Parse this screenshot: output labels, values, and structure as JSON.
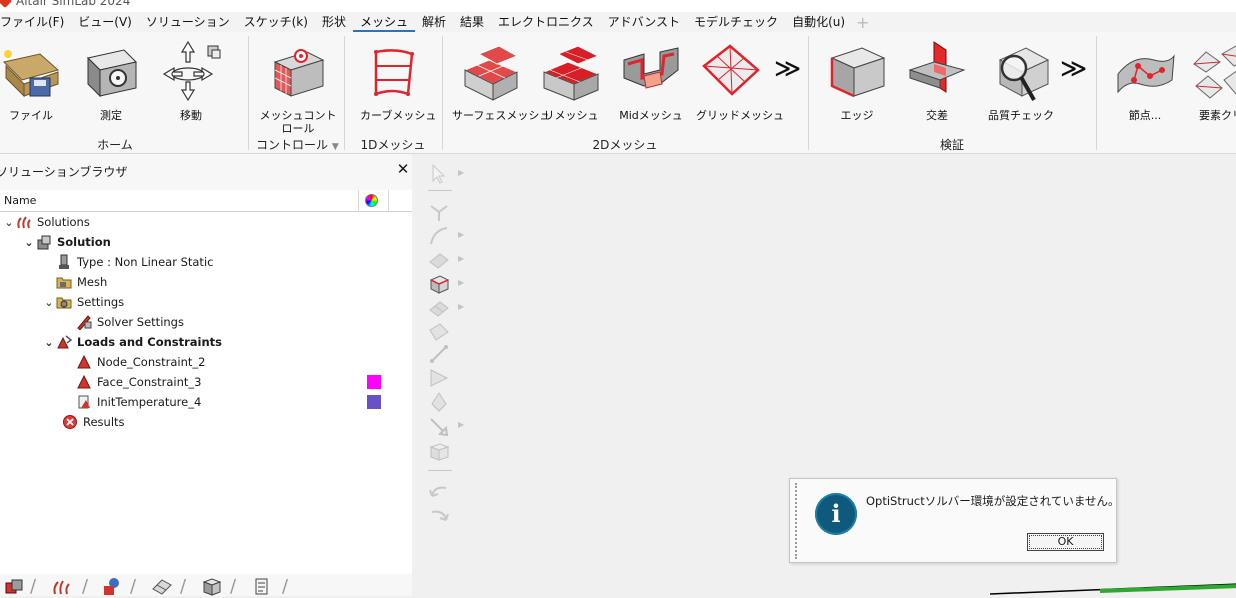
{
  "app": {
    "title": "Altair SimLab 2024"
  },
  "menu": {
    "items": [
      "ファイル(F)",
      "ビュー(V)",
      "ソリューション",
      "スケッチ(k)",
      "形状",
      "メッシュ",
      "解析",
      "結果",
      "エレクトロニクス",
      "アドバンスト",
      "モデルチェック",
      "自動化(u)"
    ],
    "active": "メッシュ",
    "add_symbol": "+"
  },
  "ribbon": {
    "home": {
      "group": "ホーム",
      "file": "ファイル",
      "measure": "測定",
      "move": "移動"
    },
    "control": {
      "group": "コントロール",
      "mesh_control": "メッシュコントロール"
    },
    "mesh1d": {
      "group": "1Dメッシュ",
      "curve_mesh": "カーブメッシュ"
    },
    "mesh2d": {
      "group": "2Dメッシュ",
      "surface_mesh": "サーフェスメッシュ",
      "remesh": "リメッシュ",
      "mid_mesh": "Midメッシュ",
      "grid_mesh": "グリッドメッシュ"
    },
    "verify": {
      "group": "検証",
      "edge": "エッジ",
      "intersect": "交差",
      "quality_check": "品質チェック"
    },
    "extra": {
      "node": "節点...",
      "element": "要素クリ"
    },
    "accent_color": "#e0242c"
  },
  "browser": {
    "title": "ソリューションブラウザ",
    "column_name": "Name",
    "close_symbol": "✕",
    "tree": [
      {
        "label": "Solutions",
        "level": 0,
        "expanded": true,
        "bold": false,
        "icon": "solutions-icon"
      },
      {
        "label": "Solution",
        "level": 1,
        "expanded": true,
        "bold": true,
        "icon": "solution-icon"
      },
      {
        "label": "Type : Non Linear Static",
        "level": 2,
        "bold": false,
        "icon": "type-icon"
      },
      {
        "label": "Mesh",
        "level": 2,
        "bold": false,
        "icon": "mesh-folder-icon"
      },
      {
        "label": "Settings",
        "level": 2,
        "expanded": true,
        "bold": false,
        "icon": "settings-folder-icon"
      },
      {
        "label": "Solver Settings",
        "level": 3,
        "bold": false,
        "icon": "solver-settings-icon"
      },
      {
        "label": "Loads and Constraints",
        "level": 2,
        "expanded": true,
        "bold": true,
        "icon": "loads-constraints-icon"
      },
      {
        "label": "Node_Constraint_2",
        "level": 3,
        "bold": false,
        "icon": "constraint-icon"
      },
      {
        "label": "Face_Constraint_3",
        "level": 3,
        "bold": false,
        "icon": "constraint-icon",
        "color": "#ff00ff"
      },
      {
        "label": "InitTemperature_4",
        "level": 3,
        "bold": false,
        "icon": "temperature-icon",
        "color": "#6a50c8"
      },
      {
        "label": "Results",
        "level": 2,
        "bold": false,
        "icon": "results-error-icon"
      }
    ]
  },
  "dialog": {
    "message": "OptiStructソルバー環境が設定されていません。",
    "ok_label": "OK",
    "icon": "info-icon",
    "icon_letter": "i"
  }
}
